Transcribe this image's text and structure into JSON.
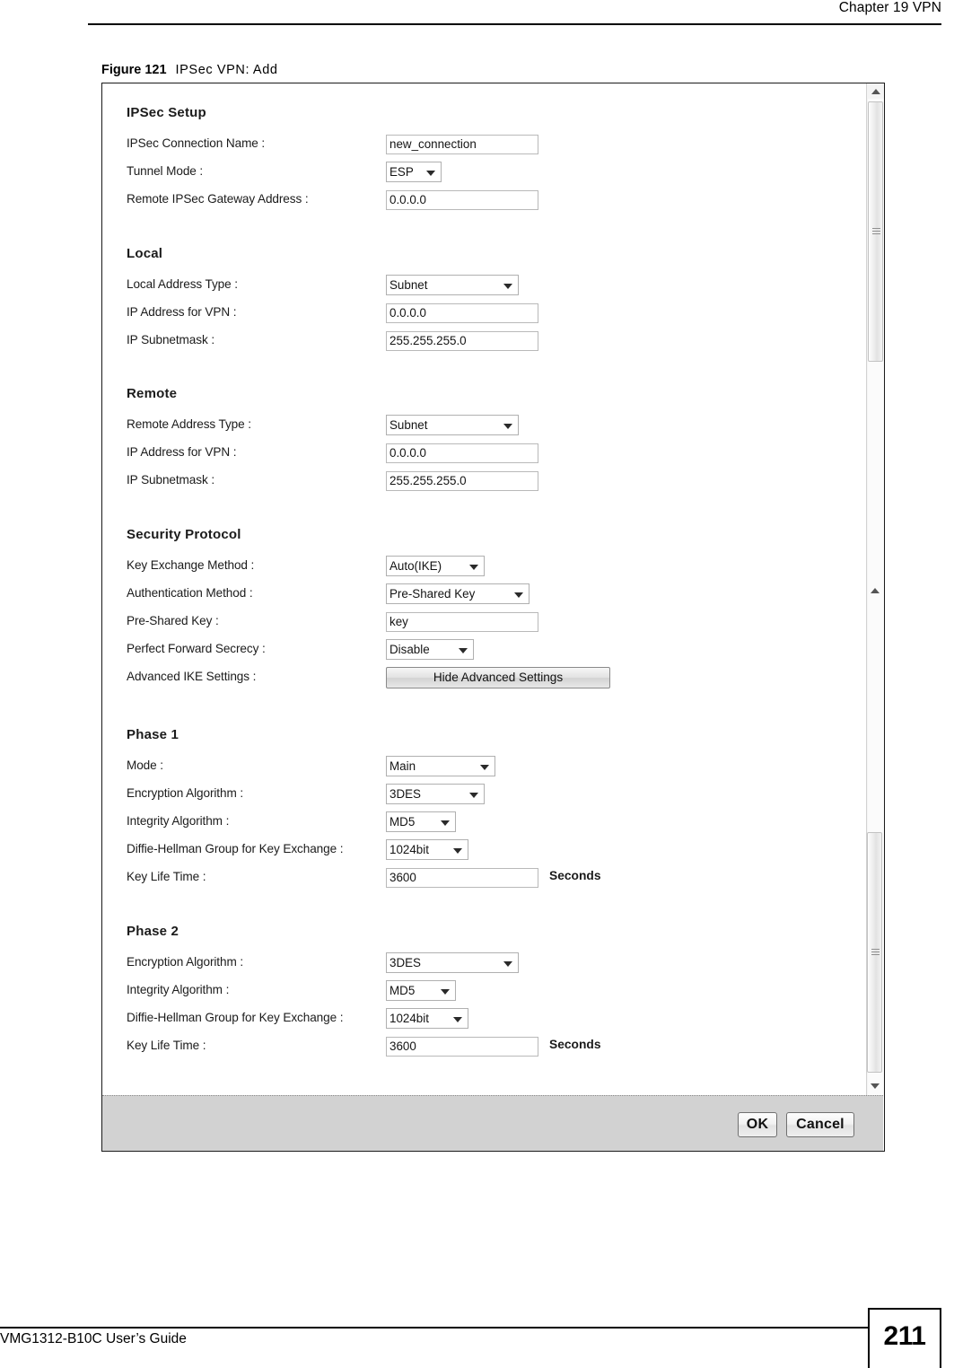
{
  "page": {
    "chapter_header": "Chapter 19 VPN",
    "footer_guide": "VMG1312-B10C User’s Guide",
    "page_number": "211"
  },
  "figure": {
    "label": "Figure 121",
    "title": "IPSec VPN: Add"
  },
  "dialog": {
    "sections": [
      {
        "id": "ipsec_setup",
        "title": "IPSec Setup",
        "rows": [
          {
            "label": "IPSec Connection Name :",
            "type": "text",
            "value": "new_connection"
          },
          {
            "label": "Tunnel Mode :",
            "type": "select",
            "value": "ESP"
          },
          {
            "label": "Remote IPSec Gateway Address :",
            "type": "text",
            "value": "0.0.0.0"
          }
        ]
      },
      {
        "id": "local",
        "title": "Local",
        "rows": [
          {
            "label": "Local Address Type :",
            "type": "select",
            "value": "Subnet"
          },
          {
            "label": "IP Address for VPN :",
            "type": "text",
            "value": "0.0.0.0"
          },
          {
            "label": "IP Subnetmask :",
            "type": "text",
            "value": "255.255.255.0"
          }
        ]
      },
      {
        "id": "remote",
        "title": "Remote",
        "rows": [
          {
            "label": "Remote Address Type :",
            "type": "select",
            "value": "Subnet"
          },
          {
            "label": "IP Address for VPN :",
            "type": "text",
            "value": "0.0.0.0"
          },
          {
            "label": "IP Subnetmask :",
            "type": "text",
            "value": "255.255.255.0"
          }
        ]
      },
      {
        "id": "security_protocol",
        "title": "Security Protocol",
        "rows": [
          {
            "label": "Key Exchange Method :",
            "type": "select",
            "value": "Auto(IKE)"
          },
          {
            "label": "Authentication Method :",
            "type": "select",
            "value": "Pre-Shared Key"
          },
          {
            "label": "Pre-Shared Key :",
            "type": "text",
            "value": "key"
          },
          {
            "label": "Perfect Forward Secrecy :",
            "type": "select",
            "value": "Disable"
          },
          {
            "label": "Advanced IKE Settings :",
            "type": "button",
            "value": "Hide Advanced Settings"
          }
        ]
      },
      {
        "id": "phase1",
        "title": "Phase 1",
        "rows": [
          {
            "label": "Mode :",
            "type": "select",
            "value": "Main"
          },
          {
            "label": "Encryption Algorithm :",
            "type": "select",
            "value": "3DES"
          },
          {
            "label": "Integrity Algorithm :",
            "type": "select",
            "value": "MD5"
          },
          {
            "label": "Diffie-Hellman Group for Key Exchange :",
            "type": "select",
            "value": "1024bit"
          },
          {
            "label": "Key Life Time :",
            "type": "text",
            "value": "3600",
            "unit": "Seconds"
          }
        ]
      },
      {
        "id": "phase2",
        "title": "Phase 2",
        "rows": [
          {
            "label": "Encryption Algorithm :",
            "type": "select",
            "value": "3DES"
          },
          {
            "label": "Integrity Algorithm :",
            "type": "select",
            "value": "MD5"
          },
          {
            "label": "Diffie-Hellman Group for Key Exchange :",
            "type": "select",
            "value": "1024bit"
          },
          {
            "label": "Key Life Time :",
            "type": "text",
            "value": "3600",
            "unit": "Seconds"
          }
        ]
      }
    ],
    "footer": {
      "ok_label": "OK",
      "cancel_label": "Cancel"
    }
  }
}
